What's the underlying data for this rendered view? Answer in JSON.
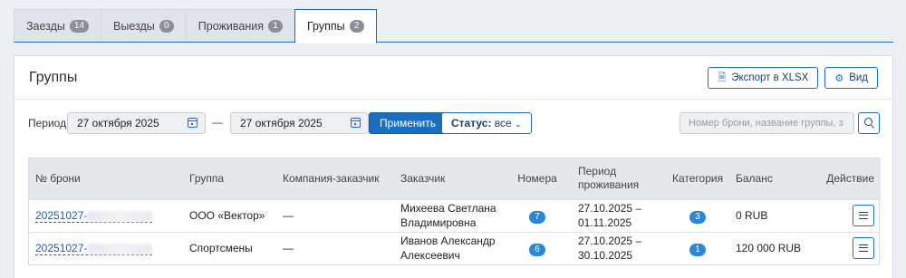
{
  "tabs": [
    {
      "label": "Заезды",
      "count": "14"
    },
    {
      "label": "Выезды",
      "count": "0"
    },
    {
      "label": "Проживания",
      "count": "1"
    },
    {
      "label": "Группы",
      "count": "2"
    }
  ],
  "panel": {
    "title": "Группы",
    "export_label": "Экспорт в XLSX",
    "view_label": "Вид"
  },
  "filters": {
    "period_label": "Период:",
    "date_from": "27 октября 2025",
    "date_separator": "—",
    "date_to": "27 октября 2025",
    "apply_label": "Применить",
    "status_prefix": "Статус:",
    "status_value": "все",
    "search_placeholder": "Номер брони, название группы, з"
  },
  "table": {
    "headers": {
      "booking": "№ брони",
      "group": "Группа",
      "company": "Компания-заказчик",
      "customer": "Заказчик",
      "rooms": "Номера",
      "period": "Период проживания",
      "category": "Категория",
      "balance": "Баланс",
      "action": "Действие"
    },
    "rows": [
      {
        "booking": "20251027-",
        "group": "ООО «Вектор»",
        "company": "—",
        "customer": "Михеева Светлана Владимировна",
        "rooms": "7",
        "period": "27.10.2025 – 01.11.2025",
        "category": "3",
        "balance": "0 RUB"
      },
      {
        "booking": "20251027-",
        "group": "Спортсмены",
        "company": "—",
        "customer": "Иванов Александр Алексеевич",
        "rooms": "6",
        "period": "27.10.2025 – 30.10.2025",
        "category": "1",
        "balance": "120 000 RUB"
      }
    ]
  },
  "icons": {
    "export": "file-export-icon",
    "view": "gear-icon",
    "calendar": "calendar-icon",
    "status_caret": "chevron-down-icon",
    "search": "search-icon",
    "row_menu": "menu-icon"
  },
  "colors": {
    "accent": "#1a6fc0",
    "pill": "#2a86d8",
    "tab_badge": "#8a9098"
  }
}
